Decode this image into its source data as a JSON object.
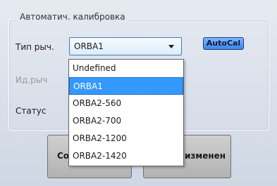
{
  "group": {
    "title": "Автоматич. калибровка"
  },
  "fields": {
    "lever_type_label": "Тип рыч.",
    "lever_id_label": "Ид.рыч",
    "status_label": "Статус"
  },
  "lever_type_combo": {
    "value": "ORBA1",
    "icon": "chevron-down-icon"
  },
  "autocal_button": {
    "label": "AutoCal"
  },
  "bottom_buttons": {
    "save_label": "Со",
    "cancel_label": "изменен"
  },
  "dropdown": {
    "options": [
      "Undefined",
      "ORBA1",
      "ORBA2-560",
      "ORBA2-700",
      "ORBA2-1200",
      "ORBA2-1420"
    ],
    "selected_index": 1
  },
  "colors": {
    "selection": "#3399ff",
    "autocal": "#3f86ea"
  }
}
